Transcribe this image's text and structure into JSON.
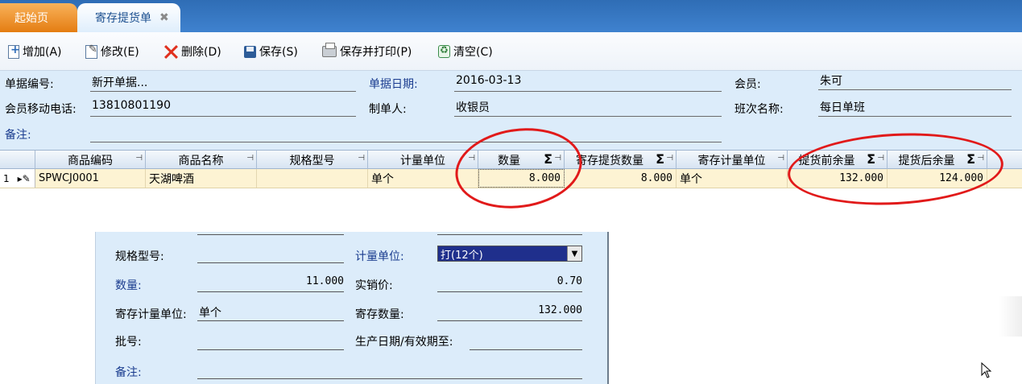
{
  "tabs": [
    {
      "label": "起始页"
    },
    {
      "label": "寄存提货单",
      "close": "✖"
    }
  ],
  "toolbar": {
    "add": "增加(A)",
    "edit": "修改(E)",
    "delete": "删除(D)",
    "save": "保存(S)",
    "save_print": "保存并打印(P)",
    "clear": "清空(C)"
  },
  "form": {
    "doc_no_label": "单据编号:",
    "doc_no": "新开单据...",
    "doc_date_label": "单据日期:",
    "doc_date": "2016-03-13",
    "member_label": "会员:",
    "member": "朱可",
    "phone_label": "会员移动电话:",
    "phone": "13810801190",
    "maker_label": "制单人:",
    "maker": "收银员",
    "shift_label": "班次名称:",
    "shift": "每日单班",
    "remark_label": "备注:"
  },
  "grid": {
    "columns": [
      "商品编码",
      "商品名称",
      "规格型号",
      "计量单位",
      "数量",
      "寄存提货数量",
      "寄存计量单位",
      "提货前余量",
      "提货后余量"
    ],
    "pin_icon": "⊣",
    "sigma": "Σ",
    "rows": [
      {
        "index": "1",
        "code": "SPWCJ0001",
        "name": "天湖啤酒",
        "spec": "",
        "unit": "单个",
        "qty": "8.000",
        "pickup_qty": "8.000",
        "deposit_unit": "单个",
        "before": "132.000",
        "after": "124.000"
      }
    ]
  },
  "detail": {
    "spec_label": "规格型号:",
    "unit_label": "计量单位:",
    "unit_value": "打(12个)",
    "qty_label": "数量:",
    "qty_value": "11.000",
    "price_label": "实销价:",
    "price_value": "0.70",
    "deposit_unit_label": "寄存计量单位:",
    "deposit_unit_value": "单个",
    "deposit_qty_label": "寄存数量:",
    "deposit_qty_value": "132.000",
    "batch_label": "批号:",
    "date_label": "生产日期/有效期至:",
    "remark_label": "备注:"
  },
  "colors": {
    "annotation": "#e11a1a",
    "tab_active_text": "#1b4f8f",
    "label_blue": "#1a3c8f",
    "row_bg": "#fdf3d3"
  }
}
